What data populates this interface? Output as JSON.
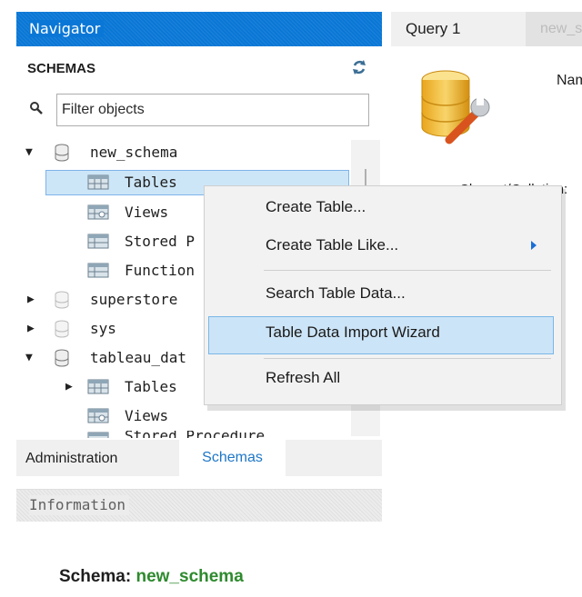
{
  "navigator": {
    "title": "Navigator",
    "schemas_title": "SCHEMAS",
    "filter_placeholder": "Filter objects"
  },
  "tree": {
    "new_schema": {
      "label": "new_schema",
      "expanded": true
    },
    "new_schema_children": {
      "tables": "Tables",
      "views": "Views",
      "stored_procedures": "Stored P",
      "functions": "Function"
    },
    "superstore": "superstore",
    "sys": "sys",
    "tableau_data": {
      "label": "tableau_dat",
      "expanded": true
    },
    "tableau_children": {
      "tables": "Tables",
      "views": "Views",
      "stored_partial": "Stored Procedures"
    }
  },
  "bottom_tabs": {
    "administration": "Administration",
    "schemas": "Schemas"
  },
  "information": {
    "title": "Information",
    "schema_label": "Schema:",
    "schema_value": "new_schema"
  },
  "editor": {
    "tab_query": "Query 1",
    "tab_new": "new_schema",
    "name_label": "Name:",
    "charset_label": "Charset/Collation:"
  },
  "context_menu": {
    "items": [
      {
        "label": "Create Table..."
      },
      {
        "label": "Create Table Like...",
        "submenu": true
      },
      {
        "label": "Search Table Data..."
      },
      {
        "label": "Table Data Import Wizard",
        "highlighted": true
      },
      {
        "label": "Refresh All"
      }
    ]
  },
  "colors": {
    "nav_header": "#0a77d6",
    "selection": "#cde6f7",
    "selection_border": "#7eb4ea",
    "schema_value": "#2e8a2e",
    "schemas_tab_text": "#1e76c8"
  }
}
